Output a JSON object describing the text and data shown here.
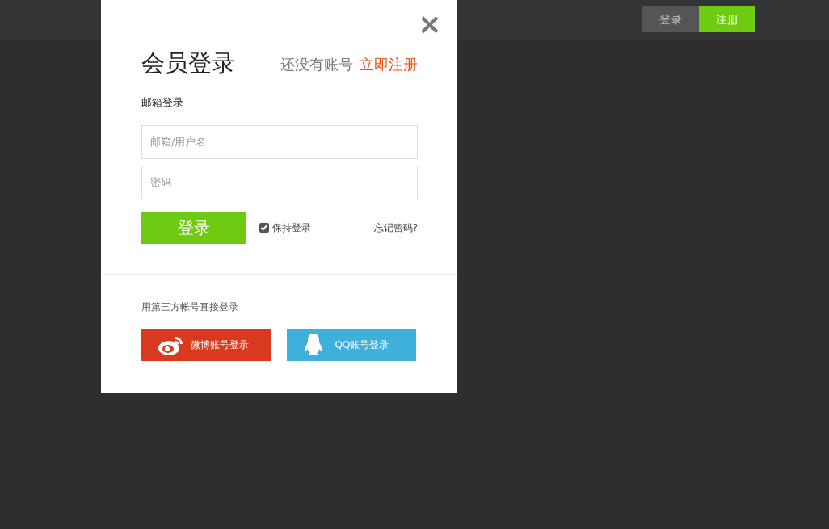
{
  "top_nav": {
    "buttons": [
      {
        "label": "登录",
        "kind": "secondary"
      },
      {
        "label": "注册",
        "kind": "primary"
      }
    ]
  },
  "modal": {
    "close": "×",
    "title": "会员登录",
    "no_account": "还没有账号",
    "register_link": "立即注册",
    "section_label": "邮箱登录",
    "fields": [
      {
        "placeholder": "邮箱/用户名"
      },
      {
        "placeholder": "密码"
      }
    ],
    "submit": "登录",
    "remember": {
      "label": "保持登录",
      "checked": true
    },
    "forgot": "忘记密码?",
    "third_party_label": "用第三方帐号直接登录",
    "social_buttons": [
      {
        "label": "微博账号登录",
        "kind": "weibo"
      },
      {
        "label": "QQ账号登录",
        "kind": "qq"
      }
    ]
  }
}
